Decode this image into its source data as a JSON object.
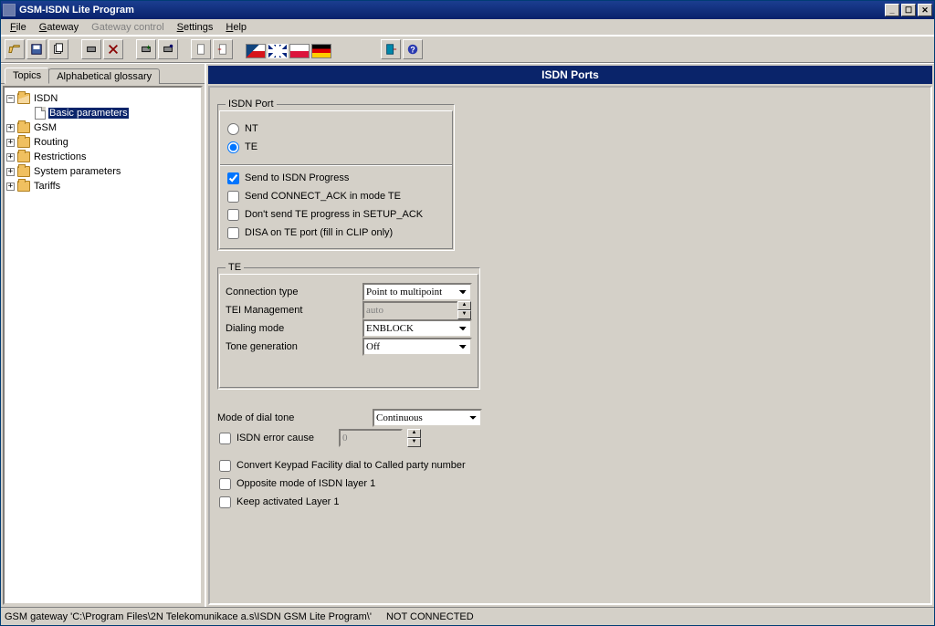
{
  "window": {
    "title": "GSM-ISDN Lite Program"
  },
  "menu": {
    "file": "File",
    "gateway": "Gateway",
    "gateway_control": "Gateway control",
    "settings": "Settings",
    "help": "Help"
  },
  "nav_tabs": {
    "topics": "Topics",
    "glossary": "Alphabetical glossary"
  },
  "tree": {
    "isdn": "ISDN",
    "isdn_basic": "Basic parameters",
    "gsm": "GSM",
    "routing": "Routing",
    "restrictions": "Restrictions",
    "system_params": "System parameters",
    "tariffs": "Tariffs"
  },
  "header": "ISDN Ports",
  "isdn_port": {
    "legend": "ISDN Port",
    "nt": "NT",
    "te": "TE",
    "send_progress": "Send to ISDN Progress",
    "send_connect_ack": "Send CONNECT_ACK in mode TE",
    "dont_send_te": "Don't send TE progress in SETUP_ACK",
    "disa": "DISA on TE port (fill in CLIP only)"
  },
  "te": {
    "legend": "TE",
    "conn_type_label": "Connection type",
    "conn_type_value": "Point to multipoint",
    "tei_label": "TEI Management",
    "tei_value": "auto",
    "dial_label": "Dialing mode",
    "dial_value": "ENBLOCK",
    "tone_label": "Tone generation",
    "tone_value": "Off"
  },
  "misc": {
    "dial_tone_label": "Mode of dial tone",
    "dial_tone_value": "Continuous",
    "error_cause_label": "ISDN error cause",
    "error_cause_value": "0",
    "convert_keypad": "Convert Keypad Facility dial to Called party number",
    "opposite_mode": "Opposite mode of ISDN layer 1",
    "keep_layer1": "Keep activated Layer 1"
  },
  "status": {
    "path": "GSM gateway 'C:\\Program Files\\2N Telekomunikace a.s\\ISDN GSM Lite Program\\'",
    "conn": "NOT CONNECTED"
  }
}
